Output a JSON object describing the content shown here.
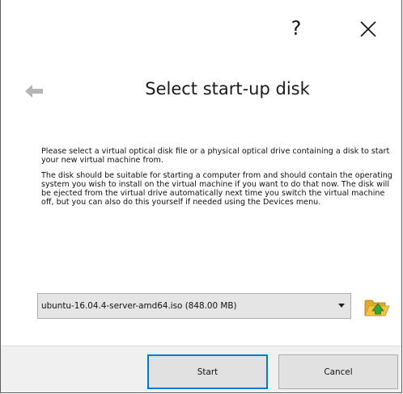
{
  "titlebar": {
    "help_label": "?",
    "close_icon": "close-icon"
  },
  "header": {
    "back_icon": "back-arrow-icon",
    "title": "Select start-up disk"
  },
  "body": {
    "paragraph1": "Please select a virtual optical disk file or a physical optical drive containing a disk to start your new virtual machine from.",
    "paragraph2": "The disk should be suitable for starting a computer from and should contain the operating system you wish to install on the virtual machine if you want to do that now. The disk will be ejected from the virtual drive automatically next time you switch the virtual machine off, but you can also do this yourself if needed using the Devices menu."
  },
  "disk_selector": {
    "selected_value": "ubuntu-16.04.4-server-amd64.iso (848.00 MB)",
    "dropdown_icon": "chevron-down-icon",
    "browse_icon": "folder-open-icon"
  },
  "buttons": {
    "start_label": "Start",
    "cancel_label": "Cancel"
  },
  "colors": {
    "focus_border": "#0078d7",
    "button_bar_bg": "#f0f0f0",
    "folder_yellow": "#f6c343",
    "arrow_green": "#3aa33a"
  }
}
